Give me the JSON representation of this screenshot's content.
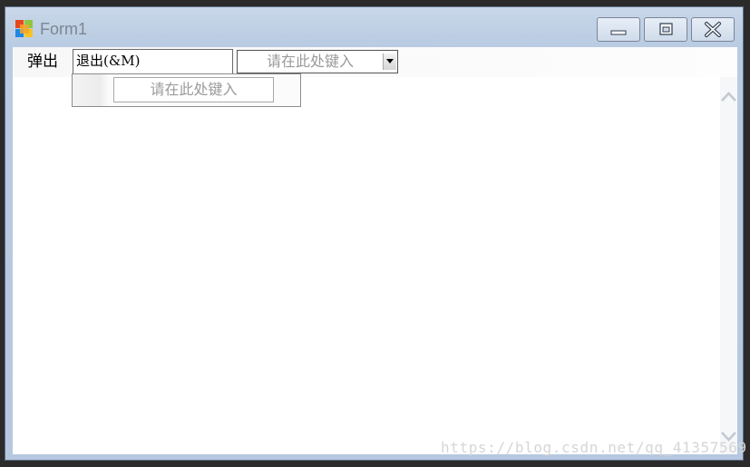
{
  "window": {
    "title": "Form1",
    "icon": "windows-form-icon",
    "controls": {
      "minimize": "minimize-icon",
      "maximize": "maximize-icon",
      "close": "close-icon"
    }
  },
  "menustrip": {
    "menu_label": "弹出",
    "textbox_value": "退出(&M)",
    "combo_placeholder": "请在此处键入",
    "combo_arrow": "chevron-down-icon"
  },
  "dropdown": {
    "placeholder": "请在此处键入"
  },
  "scrollbar": {
    "up_icon": "chevron-up-icon",
    "down_icon": "chevron-down-icon"
  },
  "watermark": "https://blog.csdn.net/qq_41357569",
  "colors": {
    "titlebar": "#c9d7e9",
    "client": "#ffffff",
    "placeholder_text": "#9a9a9a"
  }
}
